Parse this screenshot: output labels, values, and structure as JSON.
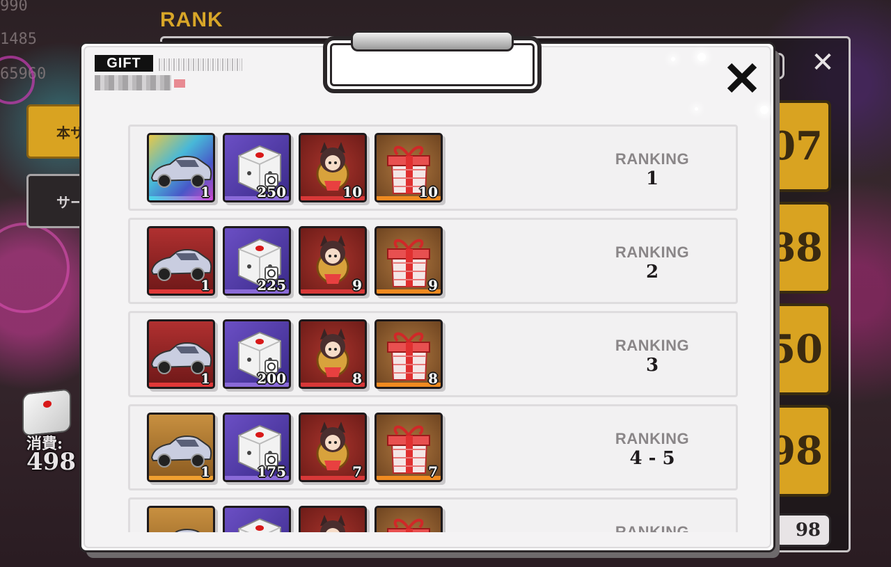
{
  "background": {
    "section_title": "RANK",
    "stats": [
      "990",
      "1485",
      "65960"
    ],
    "tab_main": "本サ",
    "tab_server": "サー",
    "right_values": [
      "07",
      "88",
      "50",
      "98"
    ],
    "bottom_value": "98",
    "cost_label": "消費:",
    "cost_value": "498"
  },
  "modal": {
    "tag": "GIFT",
    "close_icon": "close-icon",
    "rows": [
      {
        "rank_label": "RANKING",
        "rank_value": "1",
        "car_style": "rainbow",
        "items": [
          {
            "type": "car",
            "count": "1"
          },
          {
            "type": "dice",
            "count": "250"
          },
          {
            "type": "character",
            "count": "10"
          },
          {
            "type": "gift-box",
            "count": "10"
          }
        ]
      },
      {
        "rank_label": "RANKING",
        "rank_value": "2",
        "car_style": "red",
        "items": [
          {
            "type": "car",
            "count": "1"
          },
          {
            "type": "dice",
            "count": "225"
          },
          {
            "type": "character",
            "count": "9"
          },
          {
            "type": "gift-box",
            "count": "9"
          }
        ]
      },
      {
        "rank_label": "RANKING",
        "rank_value": "3",
        "car_style": "red",
        "items": [
          {
            "type": "car",
            "count": "1"
          },
          {
            "type": "dice",
            "count": "200"
          },
          {
            "type": "character",
            "count": "8"
          },
          {
            "type": "gift-box",
            "count": "8"
          }
        ]
      },
      {
        "rank_label": "RANKING",
        "rank_value": "4 - 5",
        "car_style": "gold",
        "items": [
          {
            "type": "car",
            "count": "1"
          },
          {
            "type": "dice",
            "count": "175"
          },
          {
            "type": "character",
            "count": "7"
          },
          {
            "type": "gift-box",
            "count": "7"
          }
        ]
      },
      {
        "rank_label": "RANKING",
        "rank_value": "",
        "car_style": "gold",
        "items": [
          {
            "type": "car",
            "count": ""
          },
          {
            "type": "dice",
            "count": ""
          },
          {
            "type": "character",
            "count": ""
          },
          {
            "type": "gift-box",
            "count": ""
          }
        ]
      }
    ]
  }
}
